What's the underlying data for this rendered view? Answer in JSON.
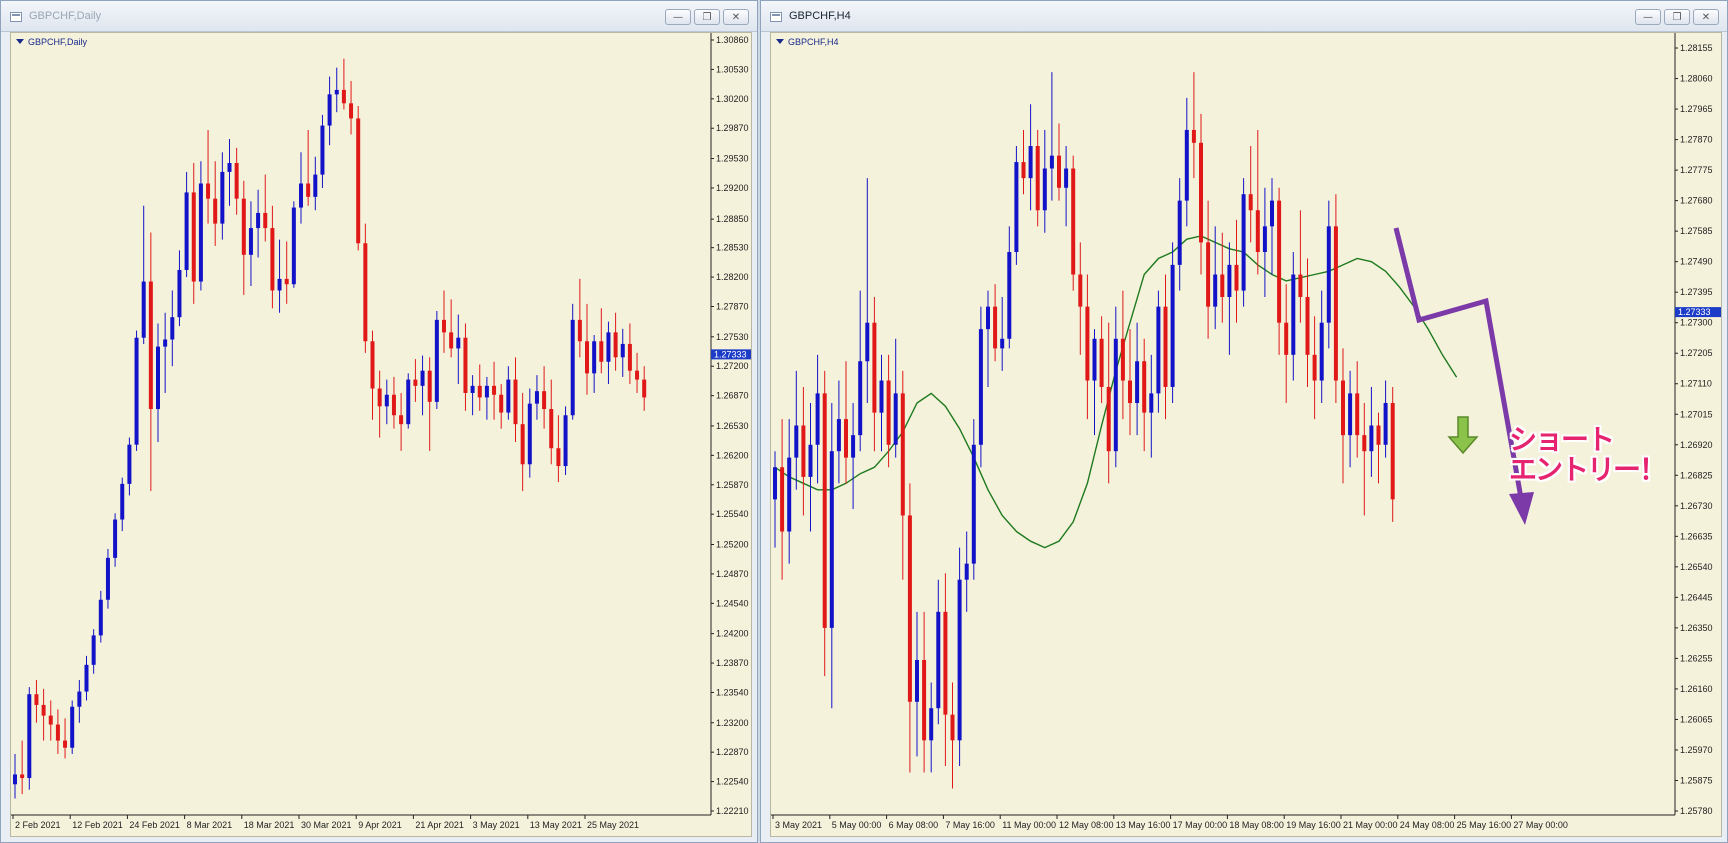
{
  "windows": [
    {
      "title": "GBPCHF,Daily",
      "buttons": [
        "—",
        "❐",
        "✕"
      ]
    },
    {
      "title": "GBPCHF,H4",
      "buttons": [
        "—",
        "❐",
        "✕"
      ]
    }
  ],
  "colors": {
    "bull": "#1212c8",
    "bear": "#e01818",
    "background": "#f5f2dc",
    "ma": "#1e7a1e",
    "arrow": "#7b3aa8",
    "price_tag": "#1c3cc8"
  },
  "chart_data": [
    {
      "type": "candlestick",
      "label": "GBPCHF,Daily",
      "ylim": [
        1.2221,
        1.3086
      ],
      "y_ticks": [
        "1.30860",
        "1.30530",
        "1.30200",
        "1.29870",
        "1.29530",
        "1.29200",
        "1.28850",
        "1.28530",
        "1.28200",
        "1.27870",
        "1.27530",
        "1.27200",
        "1.26870",
        "1.26530",
        "1.26200",
        "1.25870",
        "1.25540",
        "1.25200",
        "1.24870",
        "1.24540",
        "1.24200",
        "1.23870",
        "1.23540",
        "1.23200",
        "1.22870",
        "1.22540",
        "1.22210"
      ],
      "current_price": "1.27333",
      "x_labels": [
        "2 Feb 2021",
        "12 Feb 2021",
        "24 Feb 2021",
        "8 Mar 2021",
        "18 Mar 2021",
        "30 Mar 2021",
        "9 Apr 2021",
        "21 Apr 2021",
        "3 May 2021",
        "13 May 2021",
        "25 May 2021"
      ],
      "x_label_index": [
        0,
        8,
        16,
        24,
        32,
        40,
        48,
        56,
        64,
        72,
        80
      ],
      "ohlc": [
        [
          1.2251,
          1.2285,
          1.2235,
          1.2262
        ],
        [
          1.2262,
          1.23,
          1.224,
          1.2258
        ],
        [
          1.2258,
          1.236,
          1.2245,
          1.2352
        ],
        [
          1.2352,
          1.2368,
          1.232,
          1.234
        ],
        [
          1.234,
          1.2358,
          1.23,
          1.2328
        ],
        [
          1.2328,
          1.2345,
          1.23,
          1.2318
        ],
        [
          1.2318,
          1.2335,
          1.2285,
          1.23
        ],
        [
          1.23,
          1.2325,
          1.228,
          1.2292
        ],
        [
          1.2292,
          1.2345,
          1.2285,
          1.2338
        ],
        [
          1.2338,
          1.2368,
          1.232,
          1.2355
        ],
        [
          1.2355,
          1.2395,
          1.2345,
          1.2385
        ],
        [
          1.2385,
          1.2425,
          1.2375,
          1.2418
        ],
        [
          1.2418,
          1.2468,
          1.241,
          1.2458
        ],
        [
          1.2458,
          1.2515,
          1.2448,
          1.2505
        ],
        [
          1.2505,
          1.2555,
          1.2495,
          1.2548
        ],
        [
          1.2548,
          1.2595,
          1.2535,
          1.2588
        ],
        [
          1.2588,
          1.264,
          1.2575,
          1.2632
        ],
        [
          1.2632,
          1.276,
          1.2625,
          1.2752
        ],
        [
          1.2752,
          1.29,
          1.2745,
          1.2815
        ],
        [
          1.2815,
          1.287,
          1.258,
          1.2672
        ],
        [
          1.2672,
          1.2768,
          1.2635,
          1.2742
        ],
        [
          1.2742,
          1.278,
          1.269,
          1.275
        ],
        [
          1.275,
          1.2805,
          1.272,
          1.2775
        ],
        [
          1.2775,
          1.285,
          1.2765,
          1.2828
        ],
        [
          1.2828,
          1.2938,
          1.282,
          1.2915
        ],
        [
          1.2915,
          1.2948,
          1.279,
          1.2815
        ],
        [
          1.2815,
          1.295,
          1.2805,
          1.2925
        ],
        [
          1.2925,
          1.2985,
          1.288,
          1.2908
        ],
        [
          1.2908,
          1.295,
          1.2855,
          1.288
        ],
        [
          1.288,
          1.296,
          1.2862,
          1.2938
        ],
        [
          1.2938,
          1.2975,
          1.29,
          1.2948
        ],
        [
          1.2948,
          1.2965,
          1.289,
          1.2908
        ],
        [
          1.2908,
          1.2928,
          1.28,
          1.2845
        ],
        [
          1.2845,
          1.2905,
          1.281,
          1.2875
        ],
        [
          1.2875,
          1.2918,
          1.2842,
          1.2892
        ],
        [
          1.2892,
          1.2935,
          1.286,
          1.2875
        ],
        [
          1.2875,
          1.29,
          1.2785,
          1.2805
        ],
        [
          1.2805,
          1.2862,
          1.278,
          1.2818
        ],
        [
          1.2818,
          1.286,
          1.279,
          1.2812
        ],
        [
          1.2812,
          1.2905,
          1.2808,
          1.2898
        ],
        [
          1.2898,
          1.296,
          1.288,
          1.2925
        ],
        [
          1.2925,
          1.2985,
          1.29,
          1.291
        ],
        [
          1.291,
          1.2955,
          1.2895,
          1.2935
        ],
        [
          1.2935,
          1.3002,
          1.292,
          1.299
        ],
        [
          1.299,
          1.3045,
          1.2968,
          1.3025
        ],
        [
          1.3025,
          1.3055,
          1.3005,
          1.303
        ],
        [
          1.303,
          1.3065,
          1.3008,
          1.3015
        ],
        [
          1.3015,
          1.304,
          1.298,
          1.2998
        ],
        [
          1.2998,
          1.3012,
          1.285,
          1.2858
        ],
        [
          1.2858,
          1.288,
          1.2735,
          1.2748
        ],
        [
          1.2748,
          1.276,
          1.266,
          1.2695
        ],
        [
          1.2695,
          1.2715,
          1.264,
          1.2675
        ],
        [
          1.2675,
          1.2705,
          1.2655,
          1.2688
        ],
        [
          1.2688,
          1.2708,
          1.265,
          1.2665
        ],
        [
          1.2665,
          1.269,
          1.2625,
          1.2655
        ],
        [
          1.2655,
          1.2712,
          1.265,
          1.2705
        ],
        [
          1.2705,
          1.2728,
          1.268,
          1.2698
        ],
        [
          1.2698,
          1.2732,
          1.2665,
          1.2715
        ],
        [
          1.2715,
          1.273,
          1.2625,
          1.268
        ],
        [
          1.268,
          1.2782,
          1.2672,
          1.2772
        ],
        [
          1.2772,
          1.2805,
          1.2735,
          1.2758
        ],
        [
          1.2758,
          1.2795,
          1.273,
          1.274
        ],
        [
          1.274,
          1.2778,
          1.27,
          1.2752
        ],
        [
          1.2752,
          1.2768,
          1.267,
          1.269
        ],
        [
          1.269,
          1.271,
          1.2665,
          1.2698
        ],
        [
          1.2698,
          1.2722,
          1.267,
          1.2685
        ],
        [
          1.2685,
          1.2708,
          1.266,
          1.2698
        ],
        [
          1.2698,
          1.2725,
          1.266,
          1.2688
        ],
        [
          1.2688,
          1.27,
          1.265,
          1.2668
        ],
        [
          1.2668,
          1.272,
          1.266,
          1.2705
        ],
        [
          1.2705,
          1.273,
          1.2635,
          1.2655
        ],
        [
          1.2655,
          1.269,
          1.258,
          1.261
        ],
        [
          1.261,
          1.2695,
          1.2595,
          1.2678
        ],
        [
          1.2678,
          1.271,
          1.266,
          1.2692
        ],
        [
          1.2692,
          1.272,
          1.265,
          1.2672
        ],
        [
          1.2672,
          1.2705,
          1.261,
          1.2628
        ],
        [
          1.2628,
          1.2665,
          1.259,
          1.2608
        ],
        [
          1.2608,
          1.2675,
          1.2598,
          1.2665
        ],
        [
          1.2665,
          1.279,
          1.266,
          1.2772
        ],
        [
          1.2772,
          1.2818,
          1.273,
          1.2748
        ],
        [
          1.2748,
          1.279,
          1.2688,
          1.2712
        ],
        [
          1.2712,
          1.2755,
          1.269,
          1.2748
        ],
        [
          1.2748,
          1.2785,
          1.2712,
          1.2725
        ],
        [
          1.2725,
          1.277,
          1.27,
          1.2758
        ],
        [
          1.2758,
          1.278,
          1.2715,
          1.273
        ],
        [
          1.273,
          1.2762,
          1.2708,
          1.2745
        ],
        [
          1.2745,
          1.2768,
          1.27,
          1.2715
        ],
        [
          1.2715,
          1.2735,
          1.269,
          1.2705
        ],
        [
          1.2705,
          1.272,
          1.267,
          1.2685
        ]
      ]
    },
    {
      "type": "candlestick",
      "label": "GBPCHF,H4",
      "ylim": [
        1.2578,
        1.2818
      ],
      "y_ticks": [
        "1.28155",
        "1.28060",
        "1.27965",
        "1.27870",
        "1.27775",
        "1.27680",
        "1.27585",
        "1.27490",
        "1.27395",
        "1.27300",
        "1.27205",
        "1.27110",
        "1.27015",
        "1.26920",
        "1.26825",
        "1.26730",
        "1.26635",
        "1.26540",
        "1.26445",
        "1.26350",
        "1.26255",
        "1.26160",
        "1.26065",
        "1.25970",
        "1.25875",
        "1.25780"
      ],
      "current_price": "1.27333",
      "x_labels": [
        "3 May 2021",
        "5 May 00:00",
        "6 May 08:00",
        "7 May 16:00",
        "11 May 00:00",
        "12 May 08:00",
        "13 May 16:00",
        "17 May 00:00",
        "18 May 08:00",
        "19 May 16:00",
        "21 May 00:00",
        "24 May 08:00",
        "25 May 16:00",
        "27 May 00:00"
      ],
      "x_label_index": [
        0,
        8,
        16,
        24,
        32,
        40,
        48,
        56,
        64,
        72,
        80,
        88,
        96,
        104
      ],
      "ohlc": [
        [
          1.2675,
          1.269,
          1.266,
          1.2685
        ],
        [
          1.2685,
          1.27,
          1.265,
          1.2665
        ],
        [
          1.2665,
          1.27,
          1.2655,
          1.2688
        ],
        [
          1.2688,
          1.2715,
          1.2678,
          1.2698
        ],
        [
          1.2698,
          1.271,
          1.267,
          1.2682
        ],
        [
          1.2682,
          1.2705,
          1.2665,
          1.2692
        ],
        [
          1.2692,
          1.272,
          1.268,
          1.2708
        ],
        [
          1.2708,
          1.2715,
          1.262,
          1.2635
        ],
        [
          1.2635,
          1.2705,
          1.261,
          1.269
        ],
        [
          1.269,
          1.2712,
          1.268,
          1.27
        ],
        [
          1.27,
          1.2718,
          1.268,
          1.2688
        ],
        [
          1.2688,
          1.2705,
          1.2672,
          1.2695
        ],
        [
          1.2695,
          1.274,
          1.269,
          1.2718
        ],
        [
          1.2718,
          1.2775,
          1.2705,
          1.273
        ],
        [
          1.273,
          1.2738,
          1.269,
          1.2702
        ],
        [
          1.2702,
          1.272,
          1.269,
          1.2712
        ],
        [
          1.2712,
          1.272,
          1.2685,
          1.2692
        ],
        [
          1.2692,
          1.2725,
          1.2688,
          1.2708
        ],
        [
          1.2708,
          1.2715,
          1.265,
          1.267
        ],
        [
          1.267,
          1.268,
          1.259,
          1.2612
        ],
        [
          1.2612,
          1.264,
          1.2595,
          1.2625
        ],
        [
          1.2625,
          1.264,
          1.259,
          1.26
        ],
        [
          1.26,
          1.2618,
          1.259,
          1.261
        ],
        [
          1.261,
          1.265,
          1.2605,
          1.264
        ],
        [
          1.264,
          1.2652,
          1.2592,
          1.2608
        ],
        [
          1.2608,
          1.2618,
          1.2585,
          1.26
        ],
        [
          1.26,
          1.266,
          1.2592,
          1.265
        ],
        [
          1.265,
          1.2665,
          1.264,
          1.2655
        ],
        [
          1.2655,
          1.27,
          1.265,
          1.2692
        ],
        [
          1.2692,
          1.2735,
          1.2685,
          1.2728
        ],
        [
          1.2728,
          1.274,
          1.271,
          1.2735
        ],
        [
          1.2735,
          1.2742,
          1.2718,
          1.2722
        ],
        [
          1.2722,
          1.2738,
          1.2715,
          1.2725
        ],
        [
          1.2725,
          1.276,
          1.2722,
          1.2752
        ],
        [
          1.2752,
          1.2785,
          1.2748,
          1.278
        ],
        [
          1.278,
          1.279,
          1.277,
          1.2775
        ],
        [
          1.2775,
          1.2798,
          1.2765,
          1.2785
        ],
        [
          1.2785,
          1.279,
          1.276,
          1.2765
        ],
        [
          1.2765,
          1.279,
          1.2758,
          1.2778
        ],
        [
          1.2778,
          1.2808,
          1.2768,
          1.2782
        ],
        [
          1.2782,
          1.2792,
          1.2768,
          1.2772
        ],
        [
          1.2772,
          1.2785,
          1.276,
          1.2778
        ],
        [
          1.2778,
          1.2782,
          1.274,
          1.2745
        ],
        [
          1.2745,
          1.2755,
          1.272,
          1.2735
        ],
        [
          1.2735,
          1.2745,
          1.27,
          1.2712
        ],
        [
          1.2712,
          1.2728,
          1.2695,
          1.2725
        ],
        [
          1.2725,
          1.2732,
          1.2705,
          1.271
        ],
        [
          1.271,
          1.273,
          1.268,
          1.269
        ],
        [
          1.269,
          1.2735,
          1.2685,
          1.2725
        ],
        [
          1.2725,
          1.274,
          1.27,
          1.2712
        ],
        [
          1.2712,
          1.2728,
          1.2695,
          1.2705
        ],
        [
          1.2705,
          1.273,
          1.2695,
          1.2718
        ],
        [
          1.2718,
          1.2725,
          1.269,
          1.2702
        ],
        [
          1.2702,
          1.272,
          1.2688,
          1.2708
        ],
        [
          1.2708,
          1.274,
          1.2702,
          1.2735
        ],
        [
          1.2735,
          1.2745,
          1.27,
          1.271
        ],
        [
          1.271,
          1.2755,
          1.2705,
          1.2748
        ],
        [
          1.2748,
          1.2775,
          1.274,
          1.2768
        ],
        [
          1.2768,
          1.28,
          1.276,
          1.279
        ],
        [
          1.279,
          1.2808,
          1.2775,
          1.2786
        ],
        [
          1.2786,
          1.2795,
          1.2745,
          1.2755
        ],
        [
          1.2755,
          1.2768,
          1.2725,
          1.2735
        ],
        [
          1.2735,
          1.276,
          1.2728,
          1.2745
        ],
        [
          1.2745,
          1.2758,
          1.273,
          1.2738
        ],
        [
          1.2738,
          1.2755,
          1.272,
          1.2748
        ],
        [
          1.2748,
          1.2762,
          1.273,
          1.274
        ],
        [
          1.274,
          1.2775,
          1.2735,
          1.277
        ],
        [
          1.277,
          1.2785,
          1.2755,
          1.2765
        ],
        [
          1.2765,
          1.279,
          1.2745,
          1.2752
        ],
        [
          1.2752,
          1.2772,
          1.2738,
          1.276
        ],
        [
          1.276,
          1.2775,
          1.2745,
          1.2768
        ],
        [
          1.2768,
          1.2772,
          1.272,
          1.273
        ],
        [
          1.273,
          1.2742,
          1.2705,
          1.272
        ],
        [
          1.272,
          1.2752,
          1.2712,
          1.2745
        ],
        [
          1.2745,
          1.2765,
          1.273,
          1.2738
        ],
        [
          1.2738,
          1.275,
          1.271,
          1.272
        ],
        [
          1.272,
          1.2732,
          1.27,
          1.2712
        ],
        [
          1.2712,
          1.274,
          1.2705,
          1.273
        ],
        [
          1.273,
          1.2768,
          1.2722,
          1.276
        ],
        [
          1.276,
          1.277,
          1.2705,
          1.2712
        ],
        [
          1.2712,
          1.2722,
          1.268,
          1.2695
        ],
        [
          1.2695,
          1.2715,
          1.2685,
          1.2708
        ],
        [
          1.2708,
          1.2718,
          1.2688,
          1.2695
        ],
        [
          1.2695,
          1.2705,
          1.267,
          1.269
        ],
        [
          1.269,
          1.271,
          1.2682,
          1.2698
        ],
        [
          1.2698,
          1.2702,
          1.268,
          1.2692
        ],
        [
          1.2692,
          1.2712,
          1.2688,
          1.2705
        ],
        [
          1.2705,
          1.271,
          1.2668,
          1.2675
        ]
      ],
      "ma": [
        1.2685,
        1.2682,
        1.268,
        1.2678,
        1.2678,
        1.268,
        1.2683,
        1.2685,
        1.269,
        1.2696,
        1.2705,
        1.2708,
        1.2704,
        1.2697,
        1.2688,
        1.2678,
        1.267,
        1.2665,
        1.2662,
        1.266,
        1.2662,
        1.2668,
        1.268,
        1.2698,
        1.2715,
        1.273,
        1.2745,
        1.275,
        1.2752,
        1.2756,
        1.2757,
        1.2755,
        1.2753,
        1.2752,
        1.2748,
        1.2745,
        1.2743,
        1.2744,
        1.2745,
        1.2746,
        1.2748,
        1.275,
        1.2749,
        1.2746,
        1.2741,
        1.2735,
        1.2728,
        1.272,
        1.2713
      ]
    }
  ],
  "annotation": {
    "text_line1": "ショート",
    "text_line2": "エントリー！"
  }
}
